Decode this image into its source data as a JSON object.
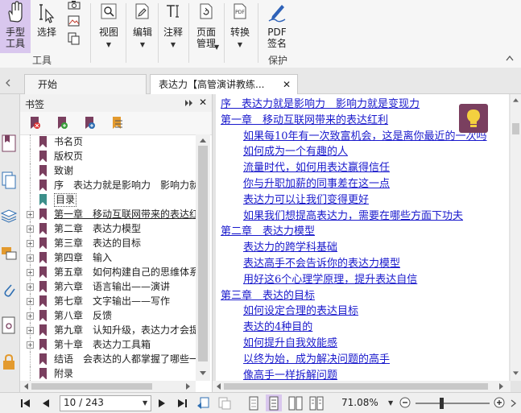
{
  "ribbon": {
    "hand_tool": "手型\n工具",
    "select": "选择",
    "view": "视图",
    "edit": "编辑",
    "annotate": "注释",
    "page_manage": "页面\n管理",
    "convert": "转换",
    "pdf_sign": "PDF\n签名",
    "protect": "保护",
    "group_tools": "工具"
  },
  "tabs": {
    "home": "开始",
    "doc": "表达力【高管演讲教练..."
  },
  "bookmarks": {
    "title": "书签",
    "items": [
      {
        "label": "书名页",
        "expandable": false
      },
      {
        "label": "版权页",
        "expandable": false
      },
      {
        "label": "致谢",
        "expandable": false
      },
      {
        "label": "序　表达力就是影响力　影响力就",
        "expandable": false
      },
      {
        "label": "目录",
        "expandable": false,
        "selected": true
      },
      {
        "label": "第一章　移动互联网带来的表达红",
        "expandable": true
      },
      {
        "label": "第二章　表达力模型",
        "expandable": true
      },
      {
        "label": "第三章　表达的目标",
        "expandable": true
      },
      {
        "label": "第四章　输入",
        "expandable": true
      },
      {
        "label": "第五章　如何构建自己的思维体系",
        "expandable": true
      },
      {
        "label": "第六章　语言输出——演讲",
        "expandable": true
      },
      {
        "label": "第七章　文字输出——写作",
        "expandable": true
      },
      {
        "label": "第八章　反馈",
        "expandable": true
      },
      {
        "label": "第九章　认知升级，表达力才会提",
        "expandable": true
      },
      {
        "label": "第十章　表达力工具箱",
        "expandable": true
      },
      {
        "label": "结语　会表达的人都掌握了哪些一",
        "expandable": false
      },
      {
        "label": "附录",
        "expandable": false
      }
    ]
  },
  "toc": [
    {
      "text": "序　表达力就是影响力　影响力就是变现力",
      "level": 0
    },
    {
      "text": "第一章　移动互联网带来的表达红利",
      "level": 0
    },
    {
      "text": "如果每10年有一次致富机会，这是离你最近的一次吗",
      "level": 1
    },
    {
      "text": "如何成为一个有趣的人",
      "level": 1
    },
    {
      "text": "流量时代，如何用表达赢得信任",
      "level": 1
    },
    {
      "text": "你与升职加薪的同事差在这一点",
      "level": 1
    },
    {
      "text": "表达力可以让我们变得更好",
      "level": 1
    },
    {
      "text": "如果我们想提高表达力，需要在哪些方面下功夫",
      "level": 1
    },
    {
      "text": "第二章　表达力模型",
      "level": 0
    },
    {
      "text": "表达力的跨学科基础",
      "level": 1
    },
    {
      "text": "表达高手不会告诉你的表达力模型",
      "level": 1
    },
    {
      "text": "用好这6个心理学原理，提升表达自信",
      "level": 1
    },
    {
      "text": "第三章　表达的目标",
      "level": 0
    },
    {
      "text": "如何设定合理的表达目标",
      "level": 1
    },
    {
      "text": "表达的4种目的",
      "level": 1
    },
    {
      "text": "如何提升自我效能感",
      "level": 1
    },
    {
      "text": "以终为始，成为解决问题的高手",
      "level": 1
    },
    {
      "text": "像高手一样拆解问题",
      "level": 1
    }
  ],
  "status": {
    "page_field": "10 / 243",
    "zoom": "71.08%"
  },
  "colors": {
    "accent": "#d9c7ee",
    "link": "#1a1acc",
    "bookmark_icon": "#7a3f5f",
    "bookmark_selected": "#3c8f8a",
    "bulb_bg": "#7a3f5f"
  }
}
